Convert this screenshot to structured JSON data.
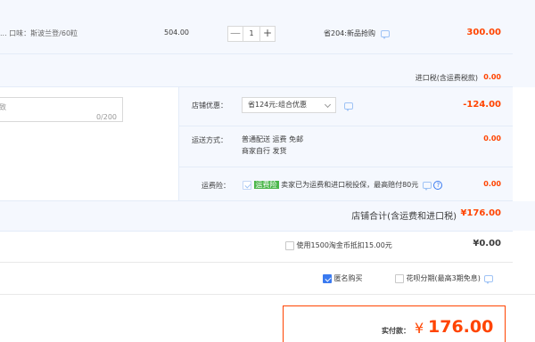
{
  "item": {
    "spec": "... 口味：斯波兰登/60粒",
    "unit_price": "504.00",
    "quantity": "1",
    "minus_label": "—",
    "plus_label": "+",
    "promo": "省204:新品抢购",
    "subtotal": "300.00"
  },
  "import_tax": {
    "label": "进口税(含运费税款)",
    "value": "0.00"
  },
  "message": {
    "placeholder_fragment": "致",
    "counter": "0/200"
  },
  "shop_discount": {
    "label": "店铺优惠：",
    "selected": "省124元:组合优惠",
    "value": "-124.00"
  },
  "delivery": {
    "label": "运送方式：",
    "line1": "普通配送 运费 免邮",
    "line2": "商家自行  发货",
    "value": "0.00"
  },
  "insurance": {
    "label": "运费险：",
    "tag": "运费险",
    "text": "卖家已为运费和进口税投保，最高赔付80元",
    "value": "0.00"
  },
  "shop_total": {
    "label": "店铺合计(含运费和进口税)",
    "value": "¥176.00"
  },
  "coins": {
    "label": "使用1500淘金币抵扣15.00元",
    "value": "¥0.00"
  },
  "options": {
    "anonymous": "匿名购买",
    "installment": "花呗分期(最高3期免息)"
  },
  "payment": {
    "label": "实付款：",
    "currency": "¥",
    "amount": "176.00"
  },
  "colors": {
    "accent_red": "#ff4400",
    "band_blue": "#f5f8fe",
    "check_blue": "#3a7af0",
    "tag_green": "#4ab64a"
  }
}
